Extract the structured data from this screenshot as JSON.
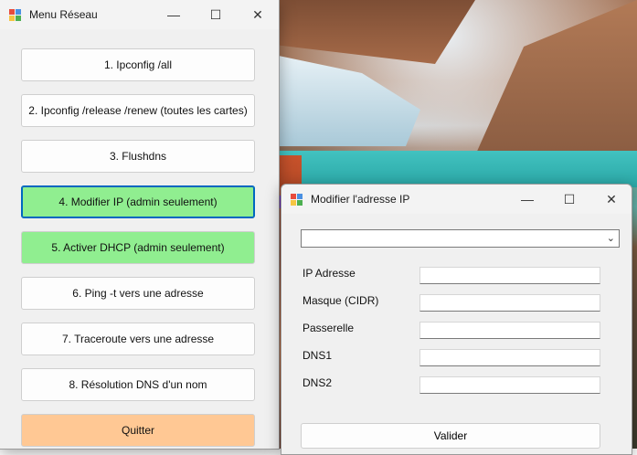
{
  "menu_window": {
    "title": "Menu Réseau",
    "buttons": [
      {
        "label": "1. Ipconfig /all"
      },
      {
        "label": "2. Ipconfig /release /renew (toutes les cartes)"
      },
      {
        "label": "3. Flushdns"
      },
      {
        "label": "4. Modifier IP (admin seulement)"
      },
      {
        "label": "5. Activer DHCP (admin seulement)"
      },
      {
        "label": "6. Ping -t vers une adresse"
      },
      {
        "label": "7. Traceroute vers une adresse"
      },
      {
        "label": "8. Résolution DNS d'un nom"
      },
      {
        "label": "Quitter"
      }
    ]
  },
  "ip_dialog": {
    "title": "Modifier l'adresse IP",
    "adapter_select": {
      "value": ""
    },
    "fields": [
      {
        "label": "IP Adresse",
        "value": ""
      },
      {
        "label": "Masque (CIDR)",
        "value": ""
      },
      {
        "label": "Passerelle",
        "value": ""
      },
      {
        "label": "DNS1",
        "value": ""
      },
      {
        "label": "DNS2",
        "value": ""
      }
    ],
    "submit_label": "Valider"
  },
  "icons": {
    "minimize": "—",
    "maximize": "☐",
    "close": "✕",
    "dropdown": "⌄"
  },
  "colors": {
    "admin_button": "#90ee90",
    "quit_button": "#ffc894",
    "focus_border": "#0067c0"
  }
}
